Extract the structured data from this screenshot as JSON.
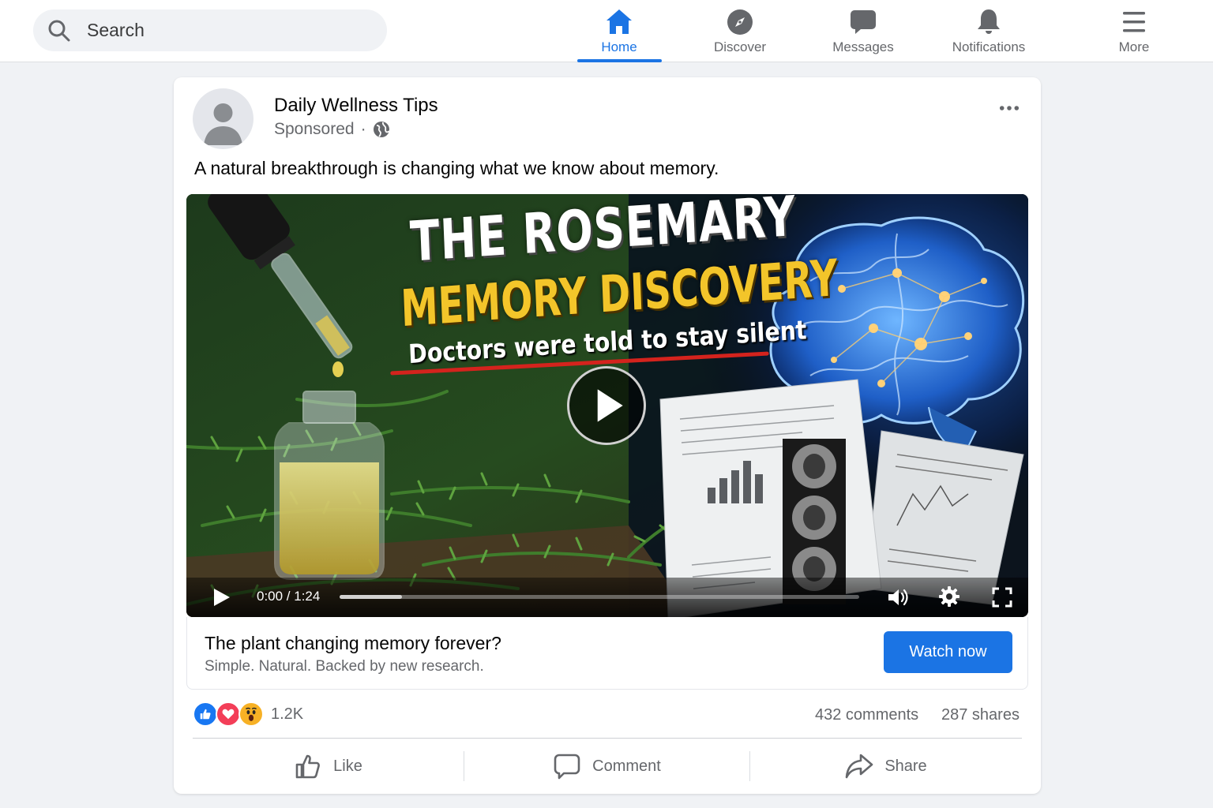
{
  "search": {
    "placeholder": "Search"
  },
  "nav": {
    "home": "Home",
    "discover": "Discover",
    "messages": "Messages",
    "notifications": "Notifications",
    "more": "More"
  },
  "colors": {
    "accent": "#1b74e4",
    "like": "#1877f2",
    "love": "#f33e58",
    "wow": "#f7b125"
  },
  "post": {
    "author": "Daily Wellness Tips",
    "sponsored": "Sponsored",
    "separator": "·",
    "caption": "A natural breakthrough is changing what we know about memory.",
    "video": {
      "headline_1": "THE ROSEMARY",
      "headline_2": "MEMORY DISCOVERY",
      "headline_3": "Doctors were told to stay silent",
      "time": "0:00 / 1:24",
      "buffered_fraction": 0.12
    },
    "link": {
      "title": "The plant changing memory forever?",
      "subtitle": "Simple. Natural. Backed by new research.",
      "cta": "Watch now"
    },
    "stats": {
      "reaction_icons": [
        "like-icon",
        "love-icon",
        "wow-icon"
      ],
      "reactions": "1.2K",
      "comments": "432 comments",
      "shares": "287 shares"
    },
    "actions": {
      "like": "Like",
      "comment": "Comment",
      "share": "Share"
    }
  }
}
